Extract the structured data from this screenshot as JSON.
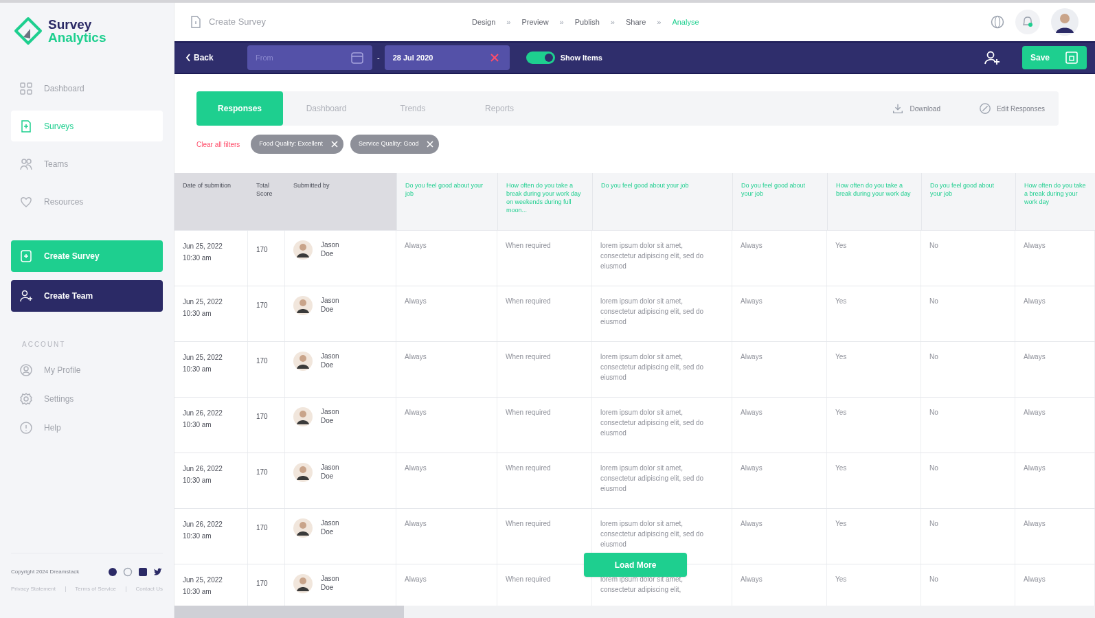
{
  "logo": {
    "line_1": "Survey",
    "line_2": "Analytics"
  },
  "sidebar": {
    "items": [
      {
        "label": "Dashboard",
        "selected": false
      },
      {
        "label": "Surveys",
        "selected": true
      },
      {
        "label": "Teams",
        "selected": false
      },
      {
        "label": "Resources",
        "selected": false
      }
    ],
    "actions": [
      {
        "label": "Create Survey",
        "kind": "primary"
      },
      {
        "label": "Create Team",
        "kind": "dark"
      }
    ],
    "account_heading": "ACCOUNT",
    "account_items": [
      {
        "label": "My Profile"
      },
      {
        "label": "Settings"
      },
      {
        "label": "Help"
      }
    ],
    "copyright": "Copyright 2024 Dreamstack",
    "footer_links": [
      "Privacy Statement",
      "Terms of Service",
      "Contact Us"
    ]
  },
  "header": {
    "title": "Create Survey",
    "steps": [
      {
        "label": "Design",
        "selected": false
      },
      {
        "label": "Preview",
        "selected": false
      },
      {
        "label": "Publish",
        "selected": false
      },
      {
        "label": "Share",
        "selected": false
      },
      {
        "label": "Analyse",
        "selected": true
      }
    ],
    "step_separator": "»"
  },
  "toolbar": {
    "back": "Back",
    "from": {
      "placeholder": "From"
    },
    "dash": "-",
    "to": {
      "value": "28 Jul 2020"
    },
    "show_items": {
      "label": "Show Items",
      "on": true
    },
    "save": "Save"
  },
  "tabs": [
    {
      "label": "Responses",
      "selected": true
    },
    {
      "label": "Dashboard",
      "selected": false
    },
    {
      "label": "Trends",
      "selected": false
    },
    {
      "label": "Reports",
      "selected": false
    }
  ],
  "tab_actions": [
    "Download",
    "Edit Responses"
  ],
  "filters": {
    "clear": "Clear all filters",
    "chips": [
      "Food Quality: Excellent",
      "Service Quality: Good"
    ]
  },
  "table": {
    "columns": [
      {
        "label": "Date of submition",
        "kind": "meta"
      },
      {
        "label": "Total Score",
        "kind": "meta"
      },
      {
        "label": "Submitted by",
        "kind": "meta"
      },
      {
        "label": "Do you feel good about your job",
        "kind": "question"
      },
      {
        "label": "How often do you take a break during your work day on weekends during full moon...",
        "kind": "question"
      },
      {
        "label": "Do you feel good about your job",
        "kind": "question"
      },
      {
        "label": "Do you feel good about your job",
        "kind": "question"
      },
      {
        "label": "How often do you take a break during your work day",
        "kind": "question"
      },
      {
        "label": "Do you feel good about your job",
        "kind": "question"
      },
      {
        "label": "How often do you take a break during your work day",
        "kind": "question"
      }
    ],
    "rows": [
      {
        "date": "Jun 25, 2022",
        "time": "10:30 am",
        "score": "170",
        "name": "Jason Doe",
        "answers": [
          "Always",
          "When required",
          "lorem ipsum dolor sit amet, consectetur adipiscing elit, sed do eiusmod",
          "Always",
          "Yes",
          "No",
          "Always"
        ]
      },
      {
        "date": "Jun 25, 2022",
        "time": "10:30 am",
        "score": "170",
        "name": "Jason Doe",
        "answers": [
          "Always",
          "When required",
          "lorem ipsum dolor sit amet, consectetur adipiscing elit, sed do eiusmod",
          "Always",
          "Yes",
          "No",
          "Always"
        ]
      },
      {
        "date": "Jun 25, 2022",
        "time": "10:30 am",
        "score": "170",
        "name": "Jason Doe",
        "answers": [
          "Always",
          "When required",
          "lorem ipsum dolor sit amet, consectetur adipiscing elit, sed do eiusmod",
          "Always",
          "Yes",
          "No",
          "Always"
        ]
      },
      {
        "date": "Jun 26, 2022",
        "time": "10:30 am",
        "score": "170",
        "name": "Jason Doe",
        "answers": [
          "Always",
          "When required",
          "lorem ipsum dolor sit amet, consectetur adipiscing elit, sed do eiusmod",
          "Always",
          "Yes",
          "No",
          "Always"
        ]
      },
      {
        "date": "Jun 26, 2022",
        "time": "10:30 am",
        "score": "170",
        "name": "Jason Doe",
        "answers": [
          "Always",
          "When required",
          "lorem ipsum dolor sit amet, consectetur adipiscing elit, sed do eiusmod",
          "Always",
          "Yes",
          "No",
          "Always"
        ]
      },
      {
        "date": "Jun 26, 2022",
        "time": "10:30 am",
        "score": "170",
        "name": "Jason Doe",
        "answers": [
          "Always",
          "When required",
          "lorem ipsum dolor sit amet, consectetur adipiscing elit, sed do eiusmod",
          "Always",
          "Yes",
          "No",
          "Always"
        ]
      },
      {
        "date": "Jun 25, 2022",
        "time": "10:30 am",
        "score": "170",
        "name": "Jason Doe",
        "answers": [
          "Always",
          "When required",
          "lorem ipsum dolor sit amet, consectetur adipiscing elit,",
          "Always",
          "Yes",
          "No",
          "Always"
        ]
      }
    ],
    "load_more": "Load More"
  }
}
